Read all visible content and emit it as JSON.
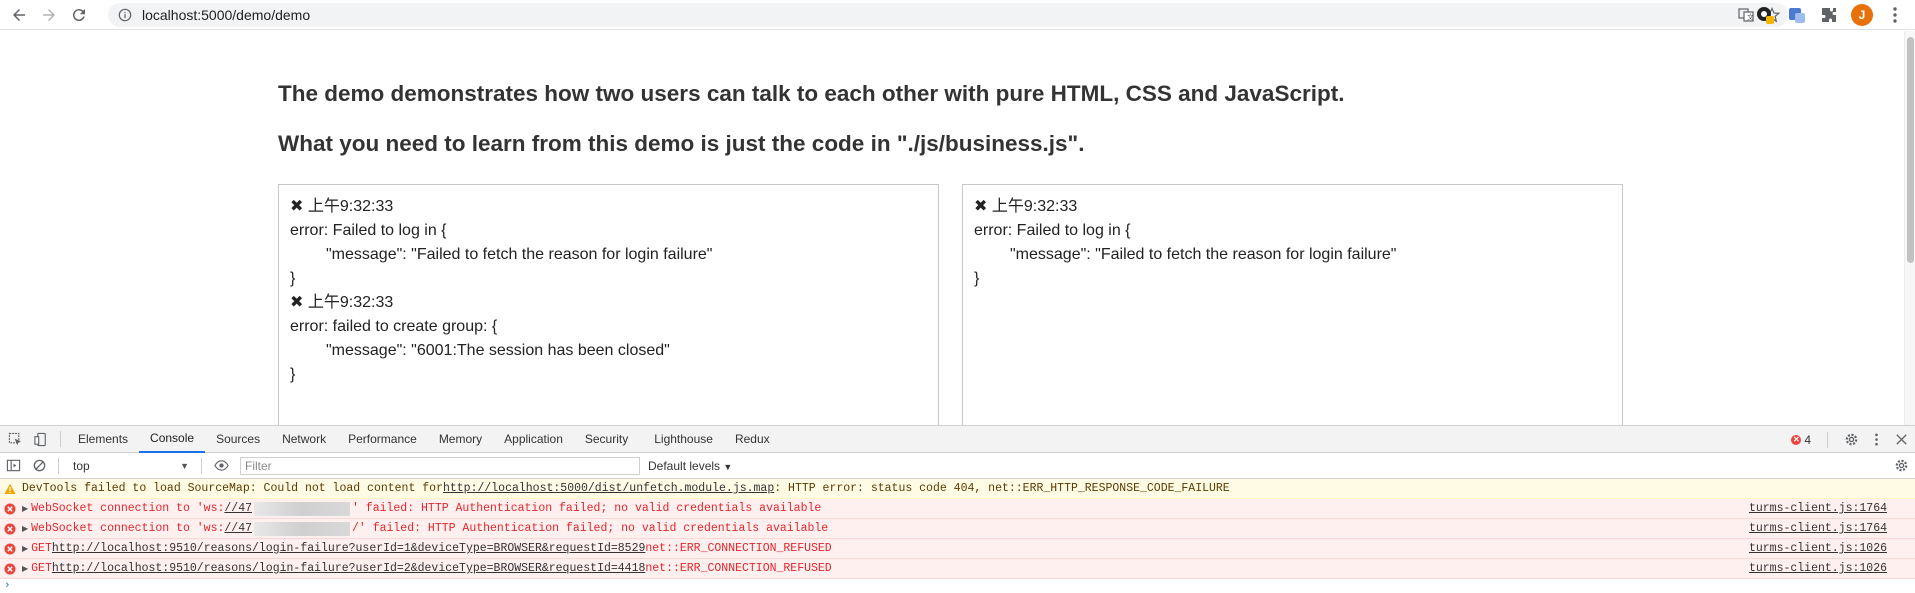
{
  "browser": {
    "url": "localhost:5000/demo/demo",
    "avatar_letter": "J"
  },
  "page": {
    "heading1": "The demo demonstrates how two users can talk to each other with pure HTML, CSS and JavaScript.",
    "heading2": "What you need to learn from this demo is just the code in \"./js/business.js\".",
    "left_log": [
      {
        "text": "✖ 上午9:32:33",
        "indent": false
      },
      {
        "text": "error: Failed to log in {",
        "indent": false
      },
      {
        "text": "\"message\": \"Failed to fetch the reason for login failure\"",
        "indent": true
      },
      {
        "text": "}",
        "indent": false
      },
      {
        "text": "✖ 上午9:32:33",
        "indent": false
      },
      {
        "text": "error: failed to create group: {",
        "indent": false
      },
      {
        "text": "\"message\": \"6001:The session has been closed\"",
        "indent": true
      },
      {
        "text": "}",
        "indent": false
      }
    ],
    "right_log": [
      {
        "text": "✖ 上午9:32:33",
        "indent": false
      },
      {
        "text": "error: Failed to log in {",
        "indent": false
      },
      {
        "text": "\"message\": \"Failed to fetch the reason for login failure\"",
        "indent": true
      },
      {
        "text": "}",
        "indent": false
      }
    ]
  },
  "devtools": {
    "tabs": [
      "Elements",
      "Console",
      "Sources",
      "Network",
      "Performance",
      "Memory",
      "Application",
      "Security",
      "Lighthouse",
      "Redux"
    ],
    "active_tab": "Console",
    "error_count": "4",
    "context": "top",
    "filter_placeholder": "Filter",
    "levels": "Default levels",
    "warning": {
      "prefix": "DevTools failed to load SourceMap: Could not load content for ",
      "link": "http://localhost:5000/dist/unfetch.module.js.map",
      "suffix": ": HTTP error: status code 404, net::ERR_HTTP_RESPONSE_CODE_FAILURE"
    },
    "errors": [
      {
        "pre": "WebSocket connection to 'ws:",
        "link": "//47",
        "post": "' failed: HTTP Authentication failed; no valid credentials available",
        "source": "turms-client.js:1764",
        "redacted": true
      },
      {
        "pre": "WebSocket connection to 'ws:",
        "link": "//47",
        "post": "/' failed: HTTP Authentication failed; no valid credentials available",
        "source": "turms-client.js:1764",
        "redacted": true
      },
      {
        "pre": "GET ",
        "link": "http://localhost:9510/reasons/login-failure?userId=1&deviceType=BROWSER&requestId=8529",
        "post": " net::ERR_CONNECTION_REFUSED",
        "source": "turms-client.js:1026",
        "redacted": false
      },
      {
        "pre": "GET ",
        "link": "http://localhost:9510/reasons/login-failure?userId=2&deviceType=BROWSER&requestId=4418",
        "post": " net::ERR_CONNECTION_REFUSED",
        "source": "turms-client.js:1026",
        "redacted": false
      }
    ]
  },
  "colors": {
    "error_red": "#e0272c",
    "warning_bg": "#fffbe5",
    "error_bg": "#fff0f0",
    "accent_blue": "#1a73e8"
  }
}
